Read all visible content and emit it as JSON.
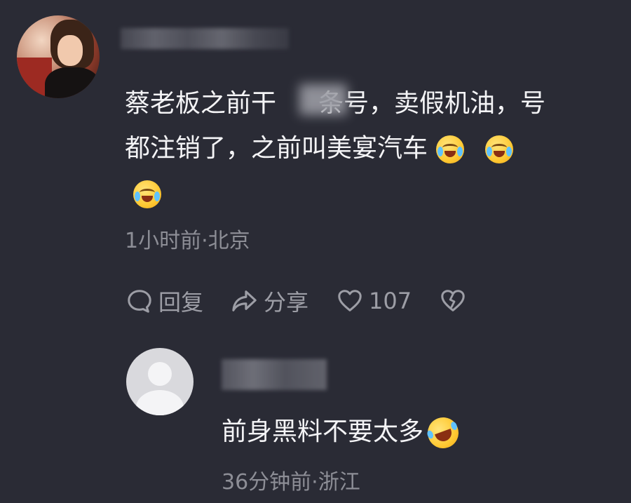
{
  "comment": {
    "text_line1": "蔡老板之前干",
    "text_line1_after_blur": "条号，卖假机油，号",
    "text_line2": "都注销了，之前叫美宴汽车",
    "emojis": [
      "crying-laughing-icon",
      "crying-laughing-icon",
      "crying-laughing-icon"
    ],
    "meta": "1小时前·北京",
    "actions": {
      "reply_label": "回复",
      "share_label": "分享",
      "like_count": "107"
    }
  },
  "reply": {
    "text": "前身黑料不要太多",
    "emoji": "rolling-laughing-icon",
    "meta": "36分钟前·浙江"
  },
  "colors": {
    "background": "#2a2b35",
    "text_primary": "#f4f4f6",
    "text_secondary": "#8d8e96",
    "action_gray": "#9d9ea6"
  }
}
